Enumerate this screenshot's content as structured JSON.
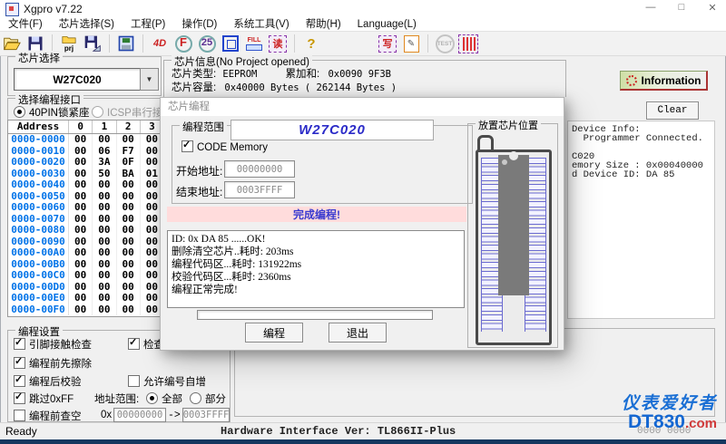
{
  "window": {
    "title": "Xgpro v7.22",
    "controls": {
      "minimize": "—",
      "maximize": "□",
      "close": "✕"
    }
  },
  "menu": {
    "items": [
      "文件(F)",
      "芯片选择(S)",
      "工程(P)",
      "操作(D)",
      "系统工具(V)",
      "帮助(H)",
      "Language(L)"
    ]
  },
  "toolbar": {
    "icons": [
      {
        "name": "open-file-icon",
        "label": ""
      },
      {
        "name": "save-file-icon",
        "label": ""
      },
      {
        "name": "open-project-icon",
        "label": "prj"
      },
      {
        "name": "save-project-icon",
        "label": ""
      },
      {
        "name": "buffer-icon",
        "label": ""
      },
      {
        "name": "search-4d-icon",
        "label": "4D"
      },
      {
        "name": "search-f-icon",
        "label": "F"
      },
      {
        "name": "search-25-icon",
        "label": "25"
      },
      {
        "name": "locate-icon",
        "label": ""
      },
      {
        "name": "fill-icon",
        "label": "FILL"
      },
      {
        "name": "read-chip-icon",
        "label": "读"
      },
      {
        "name": "help-icon",
        "label": "?"
      },
      {
        "name": "write-chip-icon",
        "label": "写"
      },
      {
        "name": "edit-buffer-icon",
        "label": ""
      },
      {
        "name": "test-icon",
        "label": "TEST"
      },
      {
        "name": "chip-pins-icon",
        "label": ""
      }
    ]
  },
  "chip_select": {
    "group_title": "芯片选择",
    "value": "W27C020"
  },
  "chip_info": {
    "group_title": "芯片信息(No Project opened)",
    "type_label": "芯片类型:",
    "type_value": "EEPROM",
    "sum_label": "累加和:",
    "sum_value": "0x0090 9F3B",
    "cap_label": "芯片容量:",
    "cap_value": "0x40000 Bytes ( 262144 Bytes )"
  },
  "information_button": {
    "label": "Information"
  },
  "interface_group": {
    "title": "选择编程接口",
    "option1": "40PIN锁紧座",
    "option2": "ICSP串行接口"
  },
  "clear_button": {
    "label": "Clear"
  },
  "hex_table": {
    "headers": [
      "Address",
      "0",
      "1",
      "2",
      "3"
    ],
    "rows": [
      {
        "address": "0000-0000",
        "values": [
          "00",
          "00",
          "00",
          "00"
        ]
      },
      {
        "address": "0000-0010",
        "values": [
          "00",
          "06",
          "F7",
          "00"
        ]
      },
      {
        "address": "0000-0020",
        "values": [
          "00",
          "3A",
          "0F",
          "00"
        ]
      },
      {
        "address": "0000-0030",
        "values": [
          "00",
          "50",
          "BA",
          "01"
        ]
      },
      {
        "address": "0000-0040",
        "values": [
          "00",
          "00",
          "00",
          "00"
        ]
      },
      {
        "address": "0000-0050",
        "values": [
          "00",
          "00",
          "00",
          "00"
        ]
      },
      {
        "address": "0000-0060",
        "values": [
          "00",
          "00",
          "00",
          "00"
        ]
      },
      {
        "address": "0000-0070",
        "values": [
          "00",
          "00",
          "00",
          "00"
        ]
      },
      {
        "address": "0000-0080",
        "values": [
          "00",
          "00",
          "00",
          "00"
        ]
      },
      {
        "address": "0000-0090",
        "values": [
          "00",
          "00",
          "00",
          "00"
        ]
      },
      {
        "address": "0000-00A0",
        "values": [
          "00",
          "00",
          "00",
          "00"
        ]
      },
      {
        "address": "0000-00B0",
        "values": [
          "00",
          "00",
          "00",
          "00"
        ]
      },
      {
        "address": "0000-00C0",
        "values": [
          "00",
          "00",
          "00",
          "00"
        ]
      },
      {
        "address": "0000-00D0",
        "values": [
          "00",
          "00",
          "00",
          "00"
        ]
      },
      {
        "address": "0000-00E0",
        "values": [
          "00",
          "00",
          "00",
          "00"
        ]
      },
      {
        "address": "0000-00F0",
        "values": [
          "00",
          "00",
          "00",
          "00"
        ]
      }
    ]
  },
  "dialog": {
    "title": "芯片编程",
    "range_group": {
      "title": "编程范围",
      "chip_banner": "W27C020",
      "code_memory_label": "CODE Memory",
      "code_memory_checked": true,
      "start_label": "开始地址:",
      "start_value": "00000000",
      "end_label": "结束地址:",
      "end_value": "0003FFFF"
    },
    "status_banner": "完成编程!",
    "log_lines": [
      "ID: 0x DA 85 ......OK!",
      "删除清空芯片..耗时: 203ms",
      "编程代码区...耗时: 131922ms",
      "校验代码区...耗时: 2360ms",
      "编程正常完成!"
    ],
    "buttons": {
      "program": "编程",
      "exit": "退出"
    },
    "socket_group": {
      "title": "放置芯片位置"
    }
  },
  "device_panel": {
    "lines": [
      "Device Info:",
      "  Programmer Connected.",
      "",
      "C020",
      "emory Size : 0x00040000",
      "d Device ID: DA 85"
    ]
  },
  "settings_group": {
    "title": "编程设置",
    "checkboxes": [
      {
        "label": "引脚接触检查",
        "checked": true
      },
      {
        "label": "检查",
        "checked": true
      },
      {
        "label": "编程前先擦除",
        "checked": true
      },
      {
        "label": "编程后校验",
        "checked": true
      },
      {
        "label": "允许编号自增",
        "checked": false
      },
      {
        "label": "跳过0xFF",
        "checked": true
      },
      {
        "label": "编程前查空",
        "checked": false
      }
    ],
    "addr_range_label": "地址范围:",
    "all_label": "全部",
    "part_label": "部分",
    "hex_prefix": "0x",
    "from_value": "00000000",
    "arrow": "->",
    "to_value": "0003FFFF"
  },
  "status_bar": {
    "ready": "Ready",
    "hardware": "Hardware Interface Ver: TL866II-Plus",
    "right_value": "0000 0000"
  },
  "watermark": {
    "line1": "仪表爱好者",
    "brand": "DT830",
    "suffix": ".com"
  },
  "colors": {
    "address_blue": "#0072e8",
    "banner_pink": "#ffdcdc",
    "banner_text": "#3b3bd0",
    "chip_banner_blue": "#2b2bc8",
    "watermark_blue": "#1a6fd4",
    "watermark_red": "#d03a3a"
  }
}
